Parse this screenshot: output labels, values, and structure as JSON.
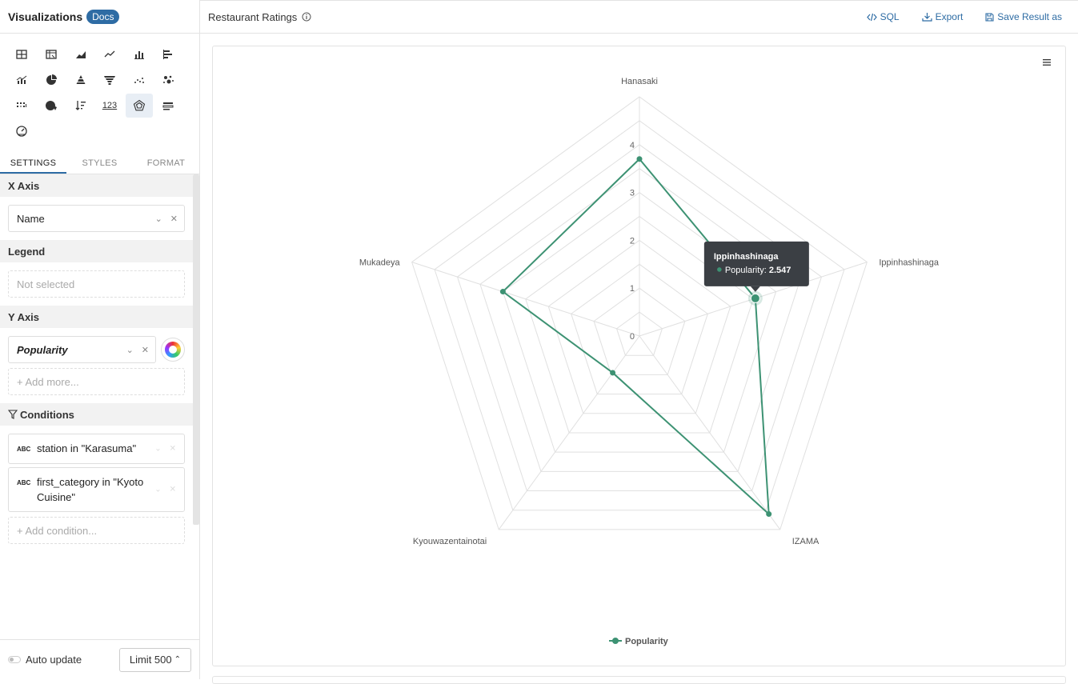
{
  "sidebar": {
    "title": "Visualizations",
    "docs_badge": "Docs",
    "viz_types": [
      "table-icon",
      "pivot-table-icon",
      "area-chart-icon",
      "line-chart-icon",
      "bar-chart-icon",
      "horizontal-bar-chart-icon",
      "combo-chart-icon",
      "pie-chart-icon",
      "pyramid-chart-icon",
      "funnel-chart-icon",
      "scatter-chart-icon",
      "bubble-chart-icon",
      "heatmap-icon",
      "map-icon",
      "sort-icon",
      "number-icon",
      "radar-chart-icon",
      "progress-icon",
      "gauge-icon"
    ],
    "number_label": "123",
    "tabs": [
      "SETTINGS",
      "STYLES",
      "FORMAT"
    ],
    "x_axis": {
      "heading": "X Axis",
      "value": "Name"
    },
    "legend": {
      "heading": "Legend",
      "placeholder": "Not selected"
    },
    "y_axis": {
      "heading": "Y Axis",
      "value": "Popularity",
      "add_more": "+ Add more..."
    },
    "conditions": {
      "heading": "Conditions",
      "items": [
        {
          "type": "ABC",
          "text": "station in \"Karasuma\""
        },
        {
          "type": "ABC",
          "text": "first_category in \"Kyoto Cuisine\""
        }
      ],
      "add_condition": "+ Add condition..."
    },
    "footer": {
      "auto_update": "Auto update",
      "limit": "Limit 500"
    }
  },
  "main": {
    "title": "Restaurant Ratings",
    "actions": {
      "sql": "SQL",
      "export": "Export",
      "save": "Save Result as"
    }
  },
  "tooltip": {
    "title": "Ippinhashinaga",
    "series": "Popularity",
    "value": "2.547"
  },
  "colors": {
    "series": "#3d9273",
    "accent": "#2e6ca4",
    "grid": "#e0e0e0",
    "tooltip_bg": "#3b3f44"
  },
  "chart_data": {
    "type": "radar",
    "categories": [
      "Hanasaki",
      "Ippinhashinaga",
      "IZAMA",
      "Kyouwazentainotai",
      "Mukadeya"
    ],
    "series": [
      {
        "name": "Popularity",
        "values": [
          3.7,
          2.547,
          4.6,
          0.95,
          3.0
        ]
      }
    ],
    "radial_ticks": [
      0,
      1,
      2,
      3,
      4
    ],
    "ylim": [
      0,
      5
    ],
    "legend": "bottom-center",
    "highlighted_category": "Ippinhashinaga"
  }
}
